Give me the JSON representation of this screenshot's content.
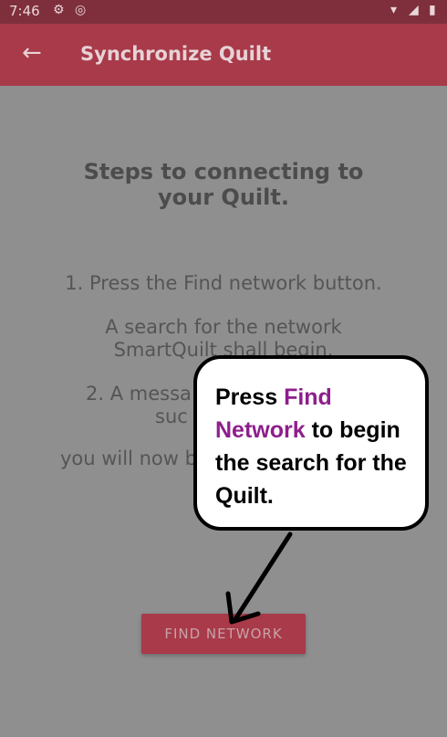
{
  "status_bar": {
    "time": "7:46",
    "icons": [
      "gear-icon",
      "sync-icon",
      "wifi-icon",
      "signal-icon",
      "battery-icon"
    ]
  },
  "app_bar": {
    "back_icon": "arrow-left-icon",
    "title": "Synchronize Quilt"
  },
  "main": {
    "heading_line1": "Steps to connecting to",
    "heading_line2": "your Quilt.",
    "step1": "1. Press the Find network button.",
    "search_line1": "A search for the network",
    "search_line2": "SmartQuilt shall begin.",
    "step2_line1": "2. A messa",
    "step2_line2": "suc",
    "step3": "you will now b",
    "find_button": "FIND NETWORK"
  },
  "callout": {
    "text_prefix": "Press ",
    "highlight": "Find Network",
    "text_suffix": " to begin the search for the Quilt."
  },
  "colors": {
    "status_bar": "#7f2f3c",
    "app_bar": "#a83a49",
    "overlay_background": "#8f8f8f",
    "callout_highlight": "#8e1e8c"
  }
}
